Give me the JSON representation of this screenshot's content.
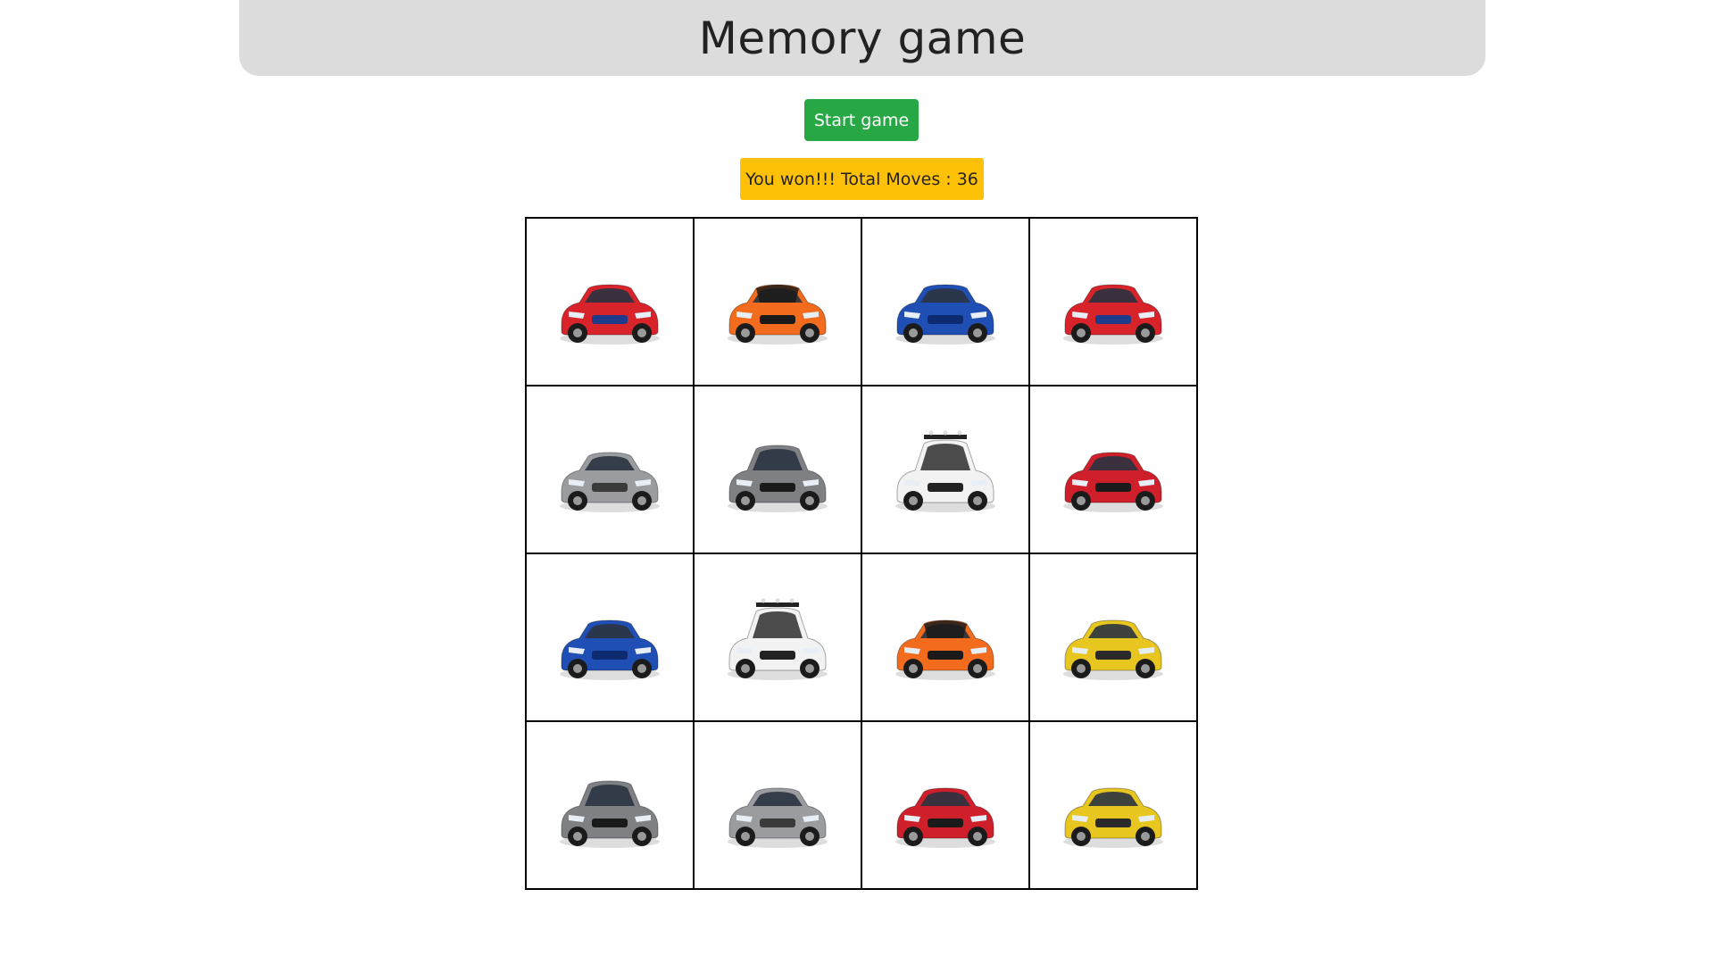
{
  "header": {
    "title": "Memory game"
  },
  "controls": {
    "start_label": "Start game"
  },
  "status": {
    "message": "You won!!! Total Moves : 36"
  },
  "cards": [
    {
      "car": "red-bmw-i8",
      "body": "#d8232a",
      "accent": "#1f3c8c"
    },
    {
      "car": "orange-sport",
      "body": "#f36b1c",
      "accent": "#1a1a1a"
    },
    {
      "car": "blue-ford-gt",
      "body": "#1f4fb5",
      "accent": "#0d2b6e"
    },
    {
      "car": "red-bmw-i8",
      "body": "#d8232a",
      "accent": "#1f3c8c"
    },
    {
      "car": "silver-mercedes-amg",
      "body": "#9a9ca0",
      "accent": "#3a3a3a"
    },
    {
      "car": "grey-audi",
      "body": "#7f8084",
      "accent": "#1a1a1a"
    },
    {
      "car": "white-jeep",
      "body": "#f2f2f2",
      "accent": "#222222"
    },
    {
      "car": "red-acura-nsx",
      "body": "#cf1f2a",
      "accent": "#1a1a1a"
    },
    {
      "car": "blue-ford-gt",
      "body": "#1f4fb5",
      "accent": "#0d2b6e"
    },
    {
      "car": "white-jeep",
      "body": "#f2f2f2",
      "accent": "#222222"
    },
    {
      "car": "orange-sport",
      "body": "#f36b1c",
      "accent": "#1a1a1a"
    },
    {
      "car": "yellow-ferrari",
      "body": "#e8c620",
      "accent": "#2a2a2a"
    },
    {
      "car": "grey-audi",
      "body": "#7f8084",
      "accent": "#1a1a1a"
    },
    {
      "car": "silver-mercedes-amg",
      "body": "#9a9ca0",
      "accent": "#3a3a3a"
    },
    {
      "car": "red-acura-nsx",
      "body": "#cf1f2a",
      "accent": "#1a1a1a"
    },
    {
      "car": "yellow-ferrari",
      "body": "#e8c620",
      "accent": "#2a2a2a"
    }
  ],
  "colors": {
    "header_bg": "#dcdcdc",
    "start_button": "#28a745",
    "status_bg": "#ffc107"
  }
}
